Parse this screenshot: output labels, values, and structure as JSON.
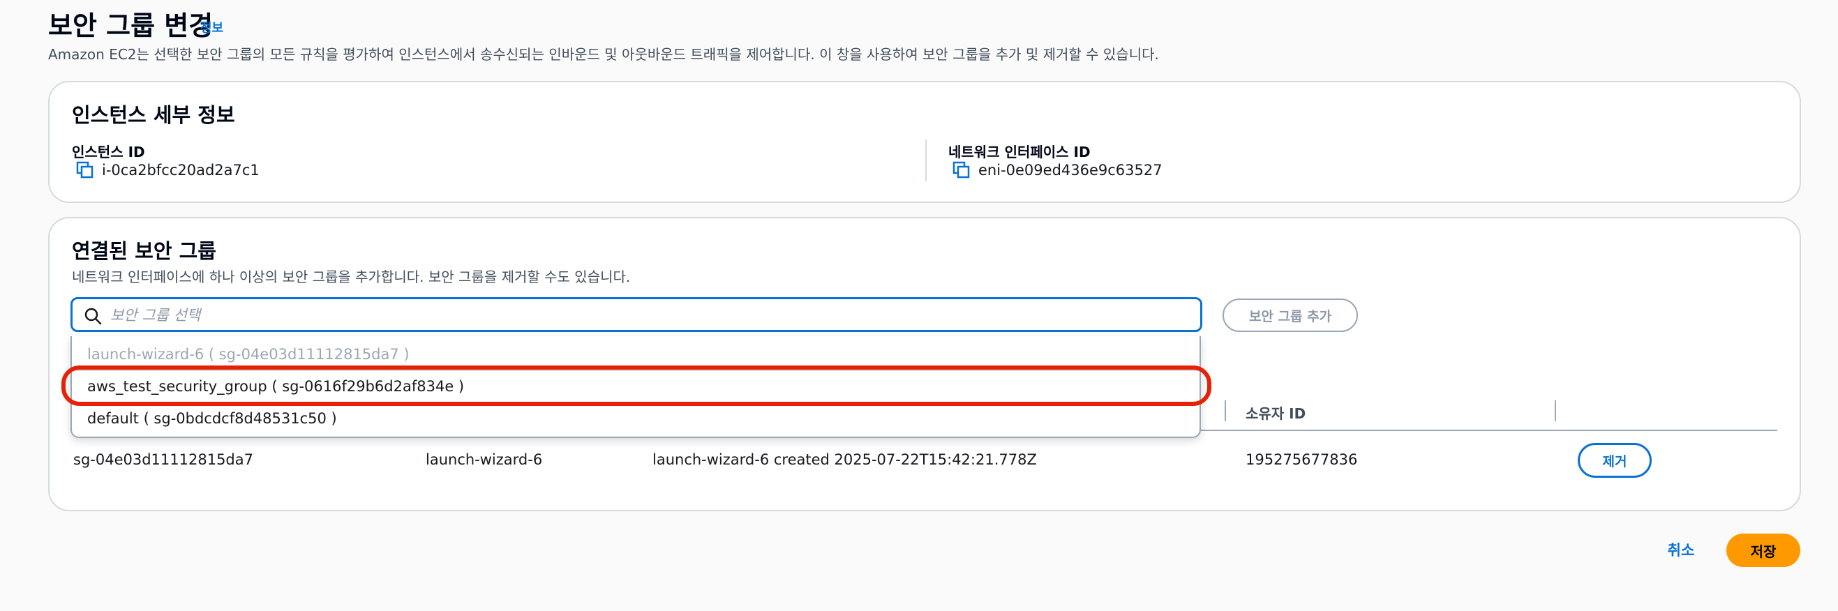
{
  "page": {
    "title": "보안 그룹 변경",
    "info_link": "정보",
    "description": "Amazon EC2는 선택한 보안 그룹의 모든 규칙을 평가하여 인스턴스에서 송수신되는 인바운드 및 아웃바운드 트래픽을 제어합니다. 이 창을 사용하여 보안 그룹을 추가 및 제거할 수 있습니다."
  },
  "instance_details": {
    "heading": "인스턴스 세부 정보",
    "instance_id_label": "인스턴스 ID",
    "instance_id": "i-0ca2bfcc20ad2a7c1",
    "eni_label": "네트워크 인터페이스 ID",
    "eni_id": "eni-0e09ed436e9c63527"
  },
  "associated_groups": {
    "heading": "연결된 보안 그룹",
    "description": "네트워크 인터페이스에 하나 이상의 보안 그룹을 추가합니다. 보안 그룹을 제거할 수도 있습니다.",
    "search_placeholder": "보안 그룹 선택",
    "add_button": "보안 그룹 추가",
    "dropdown_options": [
      {
        "label": "launch-wizard-6 ( sg-04e03d11112815da7 )",
        "disabled": true
      },
      {
        "label": "aws_test_security_group ( sg-0616f29b6d2af834e )",
        "disabled": false
      },
      {
        "label": "default ( sg-0bdcdcf8d48531c50 )",
        "disabled": false
      }
    ],
    "table": {
      "owner_header": "소유자 ID",
      "rows": [
        {
          "group_id": "sg-04e03d11112815da7",
          "name": "launch-wizard-6",
          "description": "launch-wizard-6 created 2025-07-22T15:42:21.778Z",
          "owner_id": "195275677836",
          "remove_label": "제거"
        }
      ]
    }
  },
  "footer": {
    "cancel": "취소",
    "save": "저장"
  },
  "colors": {
    "link": "#0972d3",
    "primary_button": "#ff9900",
    "highlight_oval": "#e52207",
    "border": "#d5dbdb"
  },
  "icons": [
    "copy-icon",
    "search-icon"
  ]
}
